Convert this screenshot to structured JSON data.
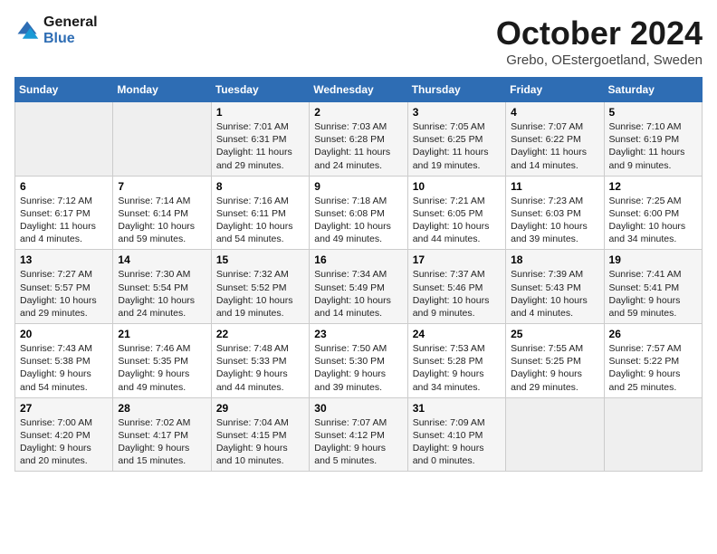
{
  "header": {
    "logo_line1": "General",
    "logo_line2": "Blue",
    "month": "October 2024",
    "location": "Grebo, OEstergoetland, Sweden"
  },
  "weekdays": [
    "Sunday",
    "Monday",
    "Tuesday",
    "Wednesday",
    "Thursday",
    "Friday",
    "Saturday"
  ],
  "weeks": [
    [
      {
        "day": "",
        "text": ""
      },
      {
        "day": "",
        "text": ""
      },
      {
        "day": "1",
        "text": "Sunrise: 7:01 AM\nSunset: 6:31 PM\nDaylight: 11 hours and 29 minutes."
      },
      {
        "day": "2",
        "text": "Sunrise: 7:03 AM\nSunset: 6:28 PM\nDaylight: 11 hours and 24 minutes."
      },
      {
        "day": "3",
        "text": "Sunrise: 7:05 AM\nSunset: 6:25 PM\nDaylight: 11 hours and 19 minutes."
      },
      {
        "day": "4",
        "text": "Sunrise: 7:07 AM\nSunset: 6:22 PM\nDaylight: 11 hours and 14 minutes."
      },
      {
        "day": "5",
        "text": "Sunrise: 7:10 AM\nSunset: 6:19 PM\nDaylight: 11 hours and 9 minutes."
      }
    ],
    [
      {
        "day": "6",
        "text": "Sunrise: 7:12 AM\nSunset: 6:17 PM\nDaylight: 11 hours and 4 minutes."
      },
      {
        "day": "7",
        "text": "Sunrise: 7:14 AM\nSunset: 6:14 PM\nDaylight: 10 hours and 59 minutes."
      },
      {
        "day": "8",
        "text": "Sunrise: 7:16 AM\nSunset: 6:11 PM\nDaylight: 10 hours and 54 minutes."
      },
      {
        "day": "9",
        "text": "Sunrise: 7:18 AM\nSunset: 6:08 PM\nDaylight: 10 hours and 49 minutes."
      },
      {
        "day": "10",
        "text": "Sunrise: 7:21 AM\nSunset: 6:05 PM\nDaylight: 10 hours and 44 minutes."
      },
      {
        "day": "11",
        "text": "Sunrise: 7:23 AM\nSunset: 6:03 PM\nDaylight: 10 hours and 39 minutes."
      },
      {
        "day": "12",
        "text": "Sunrise: 7:25 AM\nSunset: 6:00 PM\nDaylight: 10 hours and 34 minutes."
      }
    ],
    [
      {
        "day": "13",
        "text": "Sunrise: 7:27 AM\nSunset: 5:57 PM\nDaylight: 10 hours and 29 minutes."
      },
      {
        "day": "14",
        "text": "Sunrise: 7:30 AM\nSunset: 5:54 PM\nDaylight: 10 hours and 24 minutes."
      },
      {
        "day": "15",
        "text": "Sunrise: 7:32 AM\nSunset: 5:52 PM\nDaylight: 10 hours and 19 minutes."
      },
      {
        "day": "16",
        "text": "Sunrise: 7:34 AM\nSunset: 5:49 PM\nDaylight: 10 hours and 14 minutes."
      },
      {
        "day": "17",
        "text": "Sunrise: 7:37 AM\nSunset: 5:46 PM\nDaylight: 10 hours and 9 minutes."
      },
      {
        "day": "18",
        "text": "Sunrise: 7:39 AM\nSunset: 5:43 PM\nDaylight: 10 hours and 4 minutes."
      },
      {
        "day": "19",
        "text": "Sunrise: 7:41 AM\nSunset: 5:41 PM\nDaylight: 9 hours and 59 minutes."
      }
    ],
    [
      {
        "day": "20",
        "text": "Sunrise: 7:43 AM\nSunset: 5:38 PM\nDaylight: 9 hours and 54 minutes."
      },
      {
        "day": "21",
        "text": "Sunrise: 7:46 AM\nSunset: 5:35 PM\nDaylight: 9 hours and 49 minutes."
      },
      {
        "day": "22",
        "text": "Sunrise: 7:48 AM\nSunset: 5:33 PM\nDaylight: 9 hours and 44 minutes."
      },
      {
        "day": "23",
        "text": "Sunrise: 7:50 AM\nSunset: 5:30 PM\nDaylight: 9 hours and 39 minutes."
      },
      {
        "day": "24",
        "text": "Sunrise: 7:53 AM\nSunset: 5:28 PM\nDaylight: 9 hours and 34 minutes."
      },
      {
        "day": "25",
        "text": "Sunrise: 7:55 AM\nSunset: 5:25 PM\nDaylight: 9 hours and 29 minutes."
      },
      {
        "day": "26",
        "text": "Sunrise: 7:57 AM\nSunset: 5:22 PM\nDaylight: 9 hours and 25 minutes."
      }
    ],
    [
      {
        "day": "27",
        "text": "Sunrise: 7:00 AM\nSunset: 4:20 PM\nDaylight: 9 hours and 20 minutes."
      },
      {
        "day": "28",
        "text": "Sunrise: 7:02 AM\nSunset: 4:17 PM\nDaylight: 9 hours and 15 minutes."
      },
      {
        "day": "29",
        "text": "Sunrise: 7:04 AM\nSunset: 4:15 PM\nDaylight: 9 hours and 10 minutes."
      },
      {
        "day": "30",
        "text": "Sunrise: 7:07 AM\nSunset: 4:12 PM\nDaylight: 9 hours and 5 minutes."
      },
      {
        "day": "31",
        "text": "Sunrise: 7:09 AM\nSunset: 4:10 PM\nDaylight: 9 hours and 0 minutes."
      },
      {
        "day": "",
        "text": ""
      },
      {
        "day": "",
        "text": ""
      }
    ]
  ]
}
